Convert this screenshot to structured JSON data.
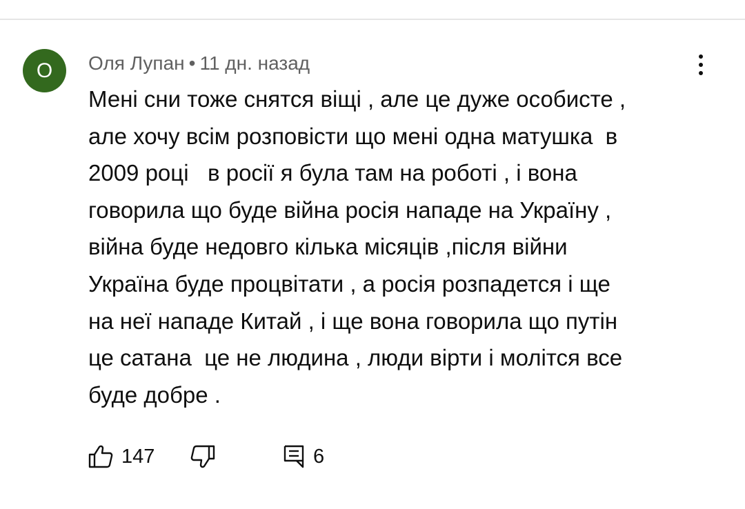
{
  "comment": {
    "avatar_letter": "О",
    "author": "Оля Лупан",
    "separator": "•",
    "time": "11 дн. назад",
    "text_lines": [
      "Мені сни тоже снятся віщі , але це дуже особисте ,",
      "але хочу всім розповісти що мені одна матушка  в",
      "2009 році   в росії я була там на роботі , і вона",
      "говорила що буде війна росія нападе на Україну ,",
      "війна буде недовго кілька місяців ,після війни",
      "Україна буде процвітати , а росія розпадется і ще",
      "на неї нападе Китай , і ще вона говорила що путін",
      "це сатана  це не людина , люди вірти і молітся все",
      "буде добре ."
    ],
    "likes": "147",
    "replies": "6"
  },
  "icons": {
    "avatar_color": "#33691e",
    "menu": "more-vertical-icon",
    "like": "thumbs-up-icon",
    "dislike": "thumbs-down-icon",
    "reply": "comment-icon"
  }
}
